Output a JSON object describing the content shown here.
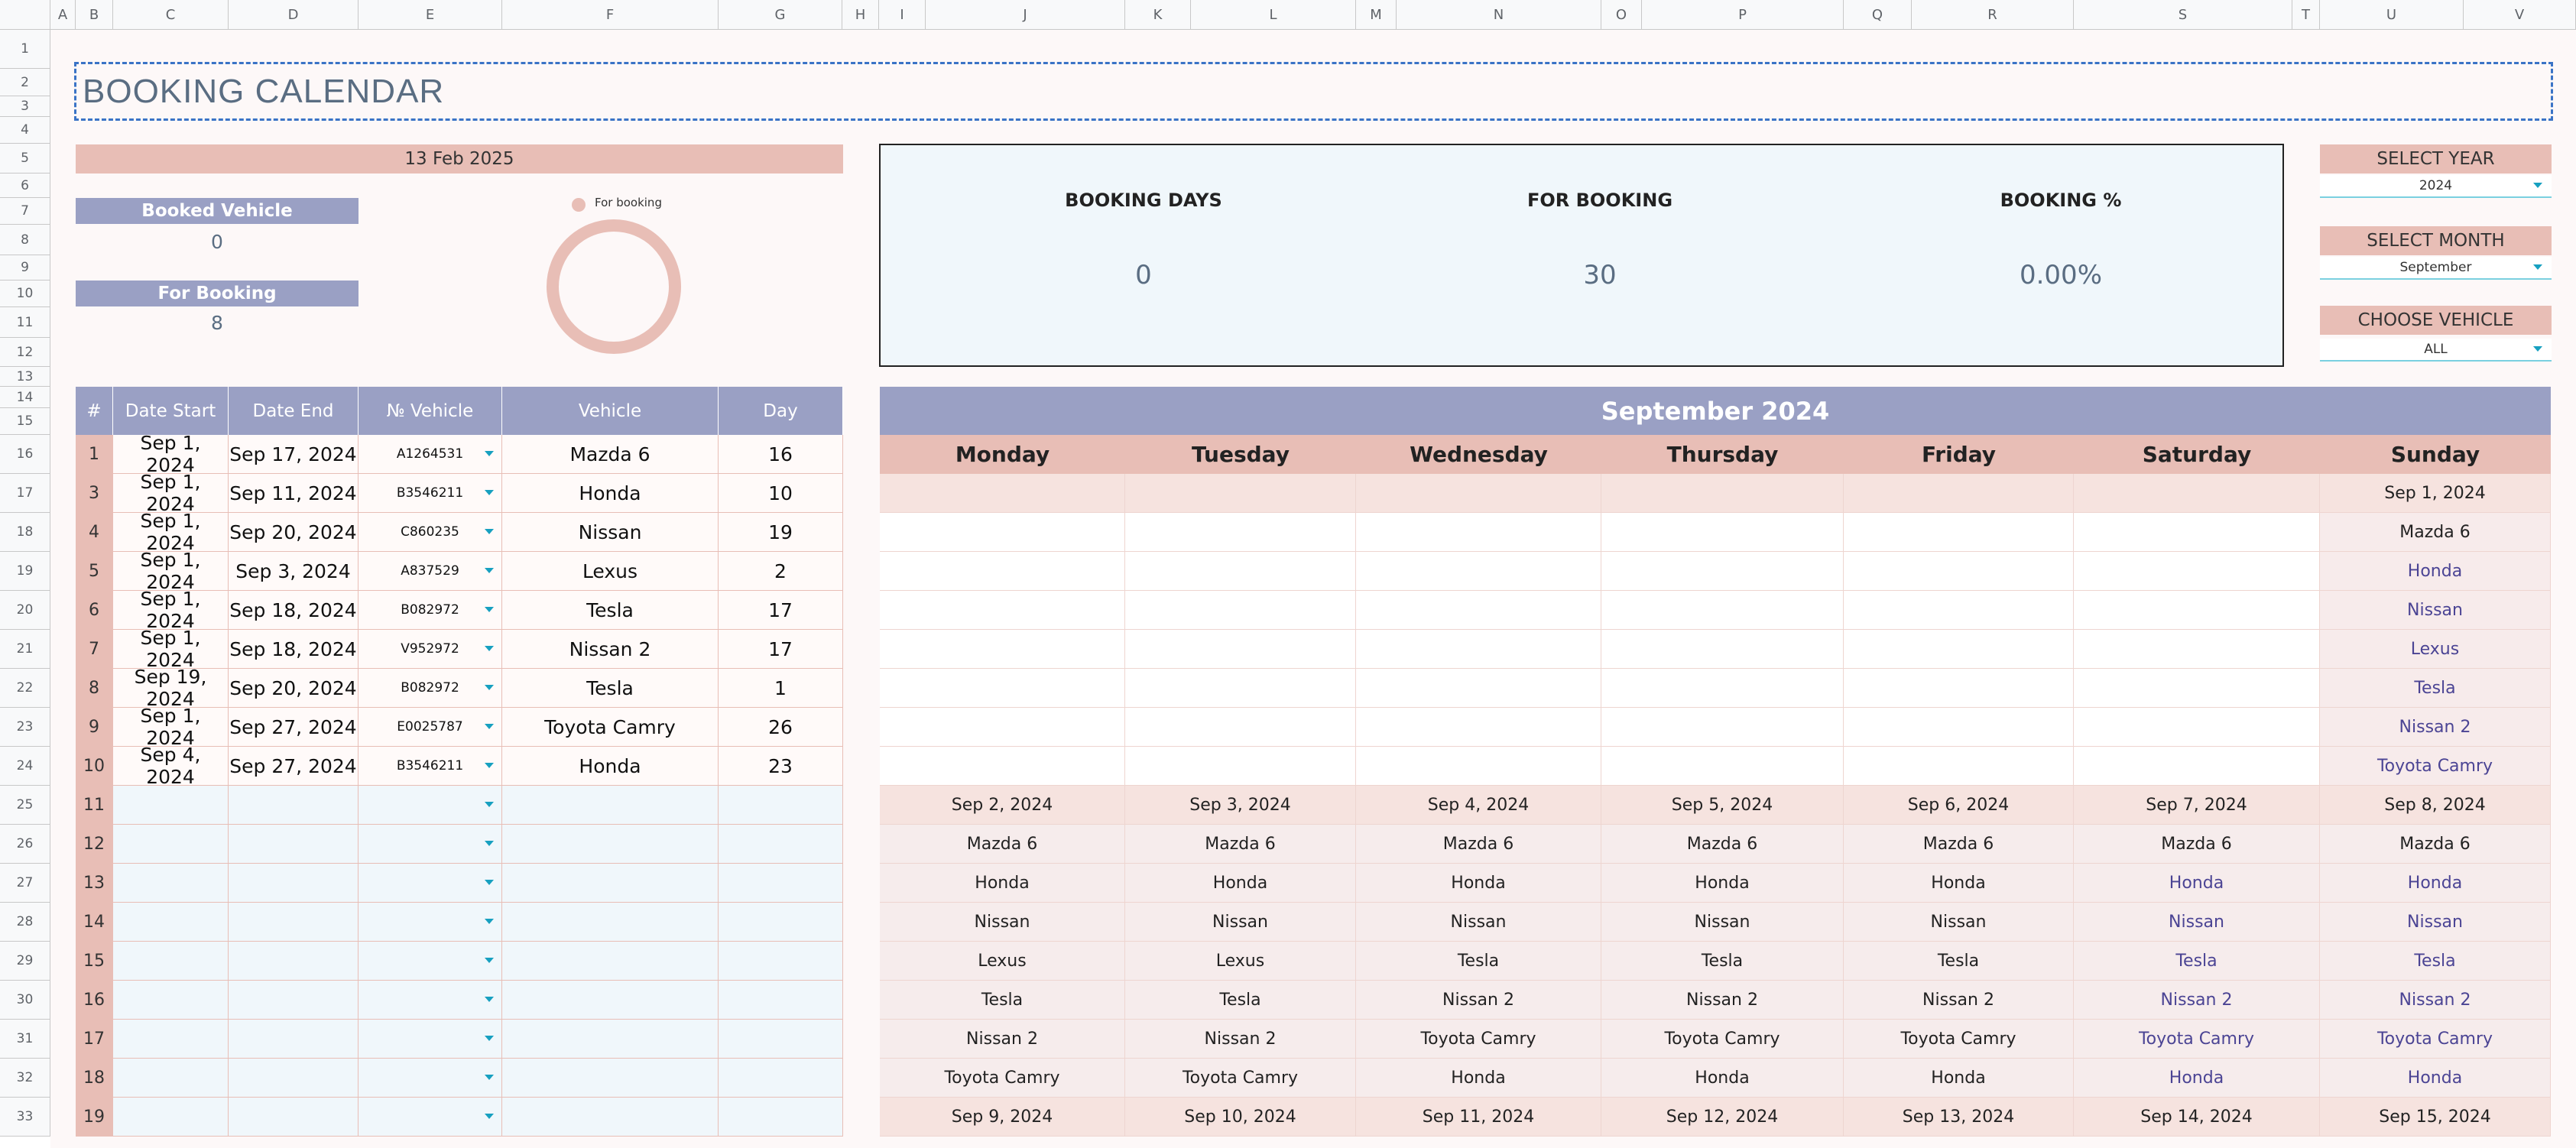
{
  "columns": [
    "A",
    "B",
    "C",
    "D",
    "E",
    "F",
    "G",
    "H",
    "I",
    "J",
    "K",
    "L",
    "M",
    "N",
    "O",
    "P",
    "Q",
    "R",
    "S",
    "T",
    "U",
    "V"
  ],
  "rows": [
    "1",
    "2",
    "3",
    "4",
    "5",
    "6",
    "7",
    "8",
    "9",
    "10",
    "11",
    "12",
    "13",
    "14",
    "15",
    "16",
    "17",
    "18",
    "19",
    "20",
    "21",
    "22",
    "23",
    "24",
    "25",
    "26",
    "27",
    "28",
    "29",
    "30",
    "31",
    "32",
    "33"
  ],
  "title": "BOOKING CALENDAR",
  "today": "13 Feb 2025",
  "booked_vehicle": {
    "label": "Booked Vehicle",
    "value": "0"
  },
  "for_booking": {
    "label": "For Booking",
    "value": "8"
  },
  "donut_legend": "For booking",
  "stats": {
    "booking_days_label": "BOOKING DAYS",
    "booking_days_value": "0",
    "for_booking_label": "FOR BOOKING",
    "for_booking_value": "30",
    "booking_pct_label": "BOOKING %",
    "booking_pct_value": "0.00%"
  },
  "selectors": {
    "year_label": "SELECT YEAR",
    "year_value": "2024",
    "month_label": "SELECT MONTH",
    "month_value": "September",
    "vehicle_label": "CHOOSE VEHICLE",
    "vehicle_value": "ALL"
  },
  "table_headers": [
    "#",
    "Date Start",
    "Date End",
    "№ Vehicle",
    "Vehicle",
    "Day"
  ],
  "bookings": [
    {
      "n": "1",
      "start": "Sep 1, 2024",
      "end": "Sep 17, 2024",
      "vid": "A1264531",
      "vehicle": "Mazda 6",
      "day": "16"
    },
    {
      "n": "3",
      "start": "Sep 1, 2024",
      "end": "Sep 11, 2024",
      "vid": "B3546211",
      "vehicle": "Honda",
      "day": "10"
    },
    {
      "n": "4",
      "start": "Sep 1, 2024",
      "end": "Sep 20, 2024",
      "vid": "C860235",
      "vehicle": "Nissan",
      "day": "19"
    },
    {
      "n": "5",
      "start": "Sep 1, 2024",
      "end": "Sep 3, 2024",
      "vid": "A837529",
      "vehicle": "Lexus",
      "day": "2"
    },
    {
      "n": "6",
      "start": "Sep 1, 2024",
      "end": "Sep 18, 2024",
      "vid": "B082972",
      "vehicle": "Tesla",
      "day": "17"
    },
    {
      "n": "7",
      "start": "Sep 1, 2024",
      "end": "Sep 18, 2024",
      "vid": "V952972",
      "vehicle": "Nissan 2",
      "day": "17"
    },
    {
      "n": "8",
      "start": "Sep 19, 2024",
      "end": "Sep 20, 2024",
      "vid": "B082972",
      "vehicle": "Tesla",
      "day": "1"
    },
    {
      "n": "9",
      "start": "Sep 1, 2024",
      "end": "Sep 27, 2024",
      "vid": "E0025787",
      "vehicle": "Toyota Camry",
      "day": "26"
    },
    {
      "n": "10",
      "start": "Sep 4, 2024",
      "end": "Sep 27, 2024",
      "vid": "B3546211",
      "vehicle": "Honda",
      "day": "23"
    },
    {
      "n": "11",
      "start": "",
      "end": "",
      "vid": "",
      "vehicle": "",
      "day": ""
    },
    {
      "n": "12",
      "start": "",
      "end": "",
      "vid": "",
      "vehicle": "",
      "day": ""
    },
    {
      "n": "13",
      "start": "",
      "end": "",
      "vid": "",
      "vehicle": "",
      "day": ""
    },
    {
      "n": "14",
      "start": "",
      "end": "",
      "vid": "",
      "vehicle": "",
      "day": ""
    },
    {
      "n": "15",
      "start": "",
      "end": "",
      "vid": "",
      "vehicle": "",
      "day": ""
    },
    {
      "n": "16",
      "start": "",
      "end": "",
      "vid": "",
      "vehicle": "",
      "day": ""
    },
    {
      "n": "17",
      "start": "",
      "end": "",
      "vid": "",
      "vehicle": "",
      "day": ""
    },
    {
      "n": "18",
      "start": "",
      "end": "",
      "vid": "",
      "vehicle": "",
      "day": ""
    },
    {
      "n": "19",
      "start": "",
      "end": "",
      "vid": "",
      "vehicle": "",
      "day": ""
    }
  ],
  "calendar": {
    "title": "September 2024",
    "days": [
      "Monday",
      "Tuesday",
      "Wednesday",
      "Thursday",
      "Friday",
      "Saturday",
      "Sunday"
    ],
    "week1": {
      "dates": [
        "",
        "",
        "",
        "",
        "",
        "",
        "Sep 1, 2024"
      ],
      "sunday_vehicles": [
        "Mazda 6",
        "Honda",
        "Nissan",
        "Lexus",
        "Tesla",
        "Nissan 2",
        "Toyota Camry"
      ]
    },
    "week2": {
      "dates": [
        "Sep 2, 2024",
        "Sep 3, 2024",
        "Sep 4, 2024",
        "Sep 5, 2024",
        "Sep 6, 2024",
        "Sep 7, 2024",
        "Sep 8, 2024"
      ],
      "vehicles": [
        [
          "Mazda 6",
          "Mazda 6",
          "Mazda 6",
          "Mazda 6",
          "Mazda 6",
          "Mazda 6",
          "Mazda 6"
        ],
        [
          "Honda",
          "Honda",
          "Honda",
          "Honda",
          "Honda",
          "Honda",
          "Honda"
        ],
        [
          "Nissan",
          "Nissan",
          "Nissan",
          "Nissan",
          "Nissan",
          "Nissan",
          "Nissan"
        ],
        [
          "Lexus",
          "Lexus",
          "Tesla",
          "Tesla",
          "Tesla",
          "Tesla",
          "Tesla"
        ],
        [
          "Tesla",
          "Tesla",
          "Nissan 2",
          "Nissan 2",
          "Nissan 2",
          "Nissan 2",
          "Nissan 2"
        ],
        [
          "Nissan 2",
          "Nissan 2",
          "Toyota Camry",
          "Toyota Camry",
          "Toyota Camry",
          "Toyota Camry",
          "Toyota Camry"
        ],
        [
          "Toyota Camry",
          "Toyota Camry",
          "Honda",
          "Honda",
          "Honda",
          "Honda",
          "Honda"
        ]
      ]
    },
    "week3": {
      "dates": [
        "Sep 9, 2024",
        "Sep 10, 2024",
        "Sep 11, 2024",
        "Sep 12, 2024",
        "Sep 13, 2024",
        "Sep 14, 2024",
        "Sep 15, 2024"
      ]
    }
  }
}
